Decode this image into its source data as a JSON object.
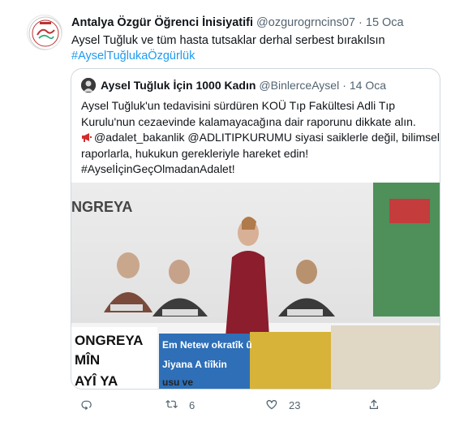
{
  "tweet": {
    "author_name": "Antalya Özgür Öğrenci İnisiyatifi",
    "handle": "@ozgurogrncins07",
    "separator": "·",
    "date": "15 Oca",
    "text": "Aysel Tuğluk ve tüm hasta tutsaklar derhal serbest bırakılsın",
    "hashtag": "#AyselTuğlukaÖzgürlük"
  },
  "quote": {
    "author_name": "Aysel Tuğluk İçin 1000 Kadın",
    "handle": "@BinlerceAysel",
    "separator": "·",
    "date": "14 Oca",
    "lines": [
      "Aysel Tuğluk'un tedavisini sürdüren KOÜ Tıp Fakültesi Adli Tıp",
      "Kurulu'nun cezaevinde kalamayacağına dair raporunu dikkate alın.",
      "@adalet_bakanlik @ADLITIPKURUMU siyasi saiklerle değil, bilimsel",
      "raporlarla, hukukun gerekleriyle hareket edin!",
      "#AyselİçinGeçOlmadanAdalet!"
    ],
    "banner_text": {
      "left_line1": "ONGREYA",
      "left_line2": "MÎN",
      "left_line3": "AYÎ YA",
      "right_line1": "Em Netew       okratîk û",
      "right_line2": "Jiyana A       tiîkin",
      "right_line3": "          usu ve"
    }
  },
  "actions": {
    "reply_count": "",
    "retweet_count": "6",
    "like_count": "23"
  },
  "colors": {
    "accent": "#1d9bf0",
    "secondary_text": "#536471",
    "border": "#cfd9de"
  },
  "icons": [
    "reply-icon",
    "retweet-icon",
    "like-icon",
    "share-icon",
    "megaphone-icon"
  ]
}
